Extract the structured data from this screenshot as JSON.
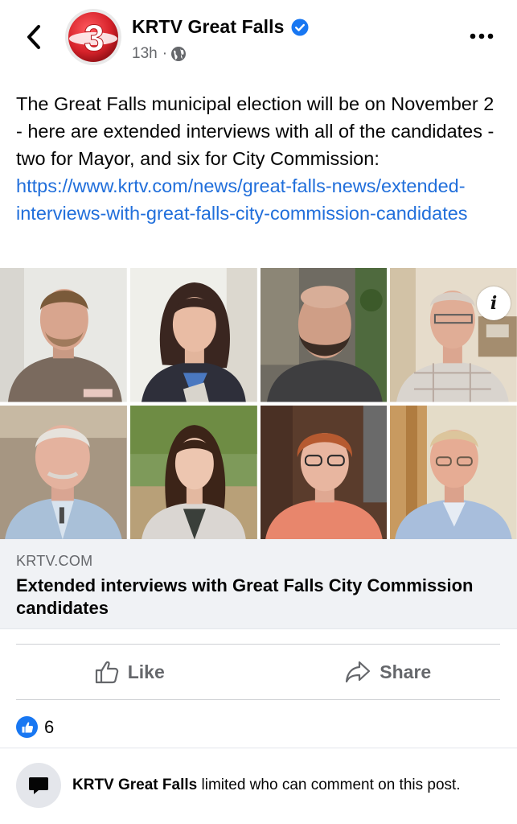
{
  "header": {
    "page_name": "KRTV Great Falls",
    "time": "13h",
    "separator": "·",
    "icons": {
      "back": "chevron-left-icon",
      "verified": "verified-badge-icon",
      "privacy": "globe-icon",
      "more": "more-horizontal-icon"
    },
    "avatar_logo": "3"
  },
  "post": {
    "text": "The Great Falls municipal election will be on November 2 - here are extended interviews with all of the candidates - two for Mayor, and six for City Commission: ",
    "link": "https://www.krtv.com/news/great-falls-news/extended-interviews-with-great-falls-city-commission-candidates"
  },
  "media": {
    "info_label": "i"
  },
  "link_card": {
    "domain": "KRTV.COM",
    "title": "Extended interviews with Great Falls City Commission candidates"
  },
  "actions": {
    "like_label": "Like",
    "share_label": "Share"
  },
  "reactions": {
    "count": "6"
  },
  "comment_notice": {
    "page_name": "KRTV Great Falls",
    "text": " limited who can comment on this post."
  },
  "colors": {
    "accent": "#1877f2",
    "link": "#216fdb",
    "secondary_text": "#65676b",
    "card_bg": "#f0f2f5",
    "logo_red": "#d6222a"
  }
}
